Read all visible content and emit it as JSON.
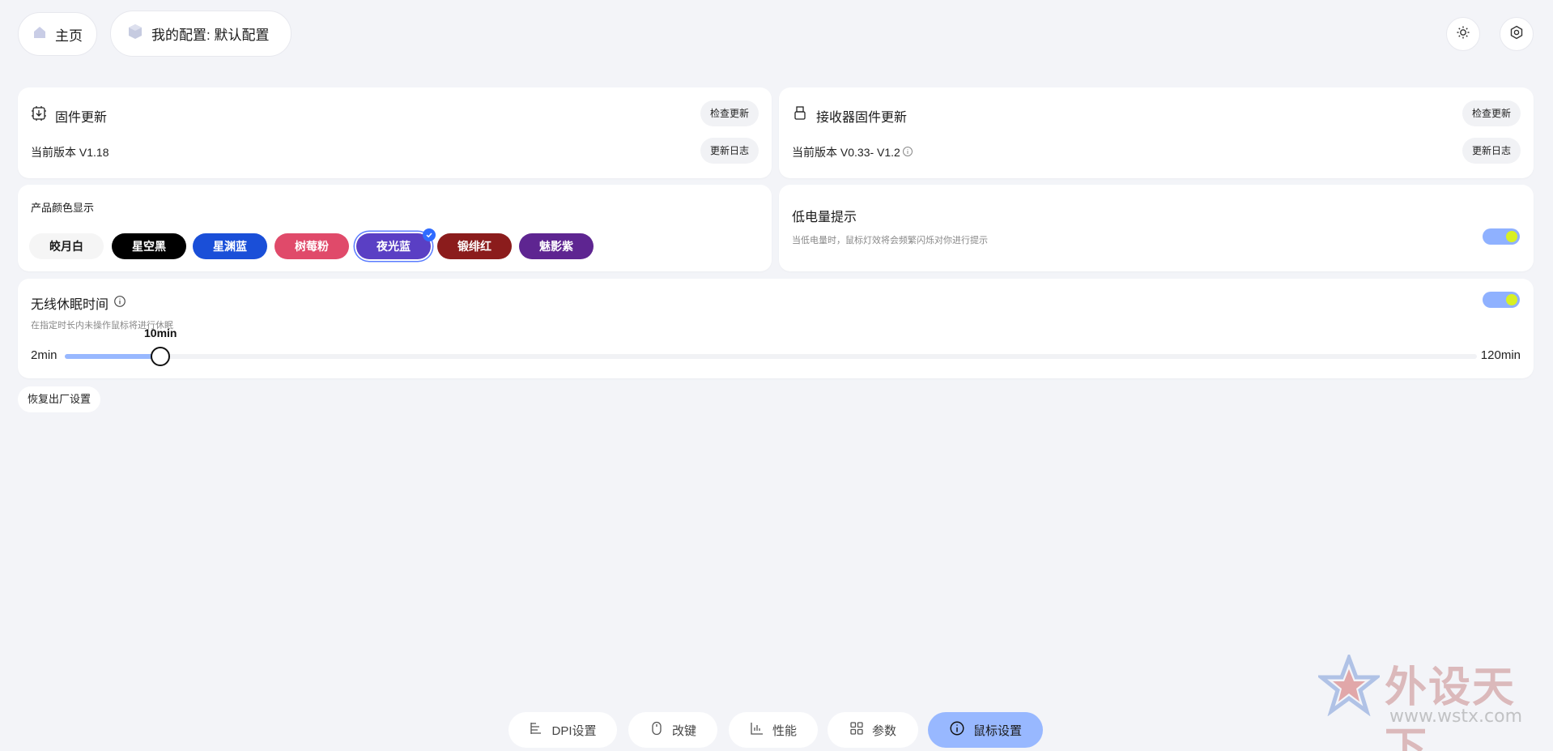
{
  "header": {
    "home_label": "主页",
    "config_label": "我的配置: 默认配置"
  },
  "firmware": {
    "title": "固件更新",
    "version": "当前版本 V1.18",
    "check_label": "检查更新",
    "log_label": "更新日志"
  },
  "receiver": {
    "title": "接收器固件更新",
    "version": "当前版本 V0.33- V1.2",
    "check_label": "检查更新",
    "log_label": "更新日志"
  },
  "product_color": {
    "title": "产品颜色显示",
    "chips": [
      {
        "label": "皎月白",
        "color": "#f5f5f5",
        "text_color": "#1a1a1a"
      },
      {
        "label": "星空黑",
        "color": "#000000",
        "text_color": "#ffffff"
      },
      {
        "label": "星渊蓝",
        "color": "#1a4fd8",
        "text_color": "#ffffff"
      },
      {
        "label": "树莓粉",
        "color": "#e04a6a",
        "text_color": "#ffffff"
      },
      {
        "label": "夜光蓝",
        "color": "#5a3fc4",
        "text_color": "#ffffff",
        "selected": true
      },
      {
        "label": "锻绯红",
        "color": "#8b1c1c",
        "text_color": "#ffffff"
      },
      {
        "label": "魅影紫",
        "color": "#5e2591",
        "text_color": "#ffffff"
      }
    ]
  },
  "low_battery": {
    "title": "低电量提示",
    "desc": "当低电量时，鼠标灯效将会频繁闪烁对你进行提示",
    "enabled": true
  },
  "sleep": {
    "title": "无线休眠时间",
    "desc": "在指定时长内未操作鼠标将进行休眠",
    "min_label": "2min",
    "max_label": "120min",
    "value_label": "10min",
    "min": 2,
    "max": 120,
    "value": 10,
    "enabled": true
  },
  "factory_reset_label": "恢复出厂设置",
  "bottom_nav": [
    {
      "label": "DPI设置",
      "icon": "dpi-icon"
    },
    {
      "label": "改键",
      "icon": "mouse-icon"
    },
    {
      "label": "性能",
      "icon": "chart-icon"
    },
    {
      "label": "参数",
      "icon": "grid-icon"
    },
    {
      "label": "鼠标设置",
      "icon": "info-icon",
      "active": true
    }
  ],
  "watermark": {
    "text": "外设天下",
    "url": "www.wstx.com"
  },
  "colors": {
    "accent": "#98b8ff",
    "toggle_on": "#8fb1ff",
    "knob": "#d8f024",
    "check": "#2f6bff"
  }
}
